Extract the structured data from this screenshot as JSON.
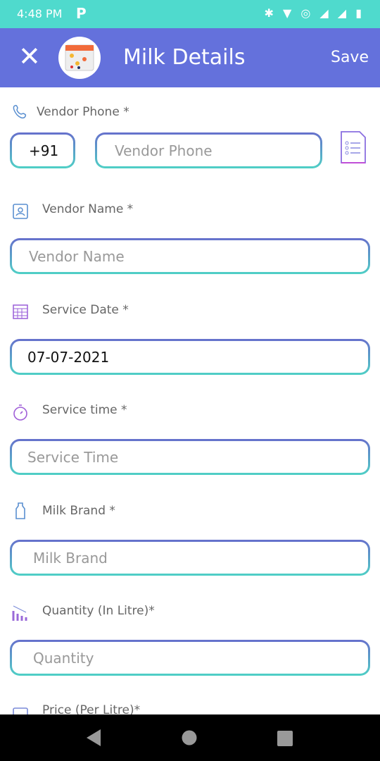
{
  "status_bar": {
    "time": "4:48 PM",
    "app_icon": "P",
    "icons": "✱ ▼ ◎ ◢ ◢ ▮"
  },
  "header": {
    "title": "Milk Details",
    "save_label": "Save",
    "close_icon": "close-icon",
    "logo": "calendar-logo"
  },
  "fields": [
    {
      "label": "Vendor Phone *",
      "country_code": "+91",
      "placeholder": "Vendor Phone",
      "icon": "phone-icon"
    },
    {
      "label": "Vendor Name *",
      "placeholder": "Vendor Name",
      "icon": "contact-icon"
    },
    {
      "label": "Service Date *",
      "value": "07-07-2021",
      "icon": "calendar-icon"
    },
    {
      "label": "Service time *",
      "placeholder": "Service Time",
      "icon": "stopwatch-icon"
    },
    {
      "label": "Milk Brand *",
      "placeholder": "Milk Brand",
      "icon": "bottle-icon"
    },
    {
      "label": "Quantity (In Litre)*",
      "placeholder": "Quantity",
      "icon": "chart-icon"
    },
    {
      "label": "Price (Per Litre)*",
      "icon": "wallet-icon"
    }
  ],
  "colors": {
    "status": "#4fdacd",
    "header": "#6471dc",
    "border_top": "#6670cc",
    "border_bottom": "#4fd0c6"
  }
}
